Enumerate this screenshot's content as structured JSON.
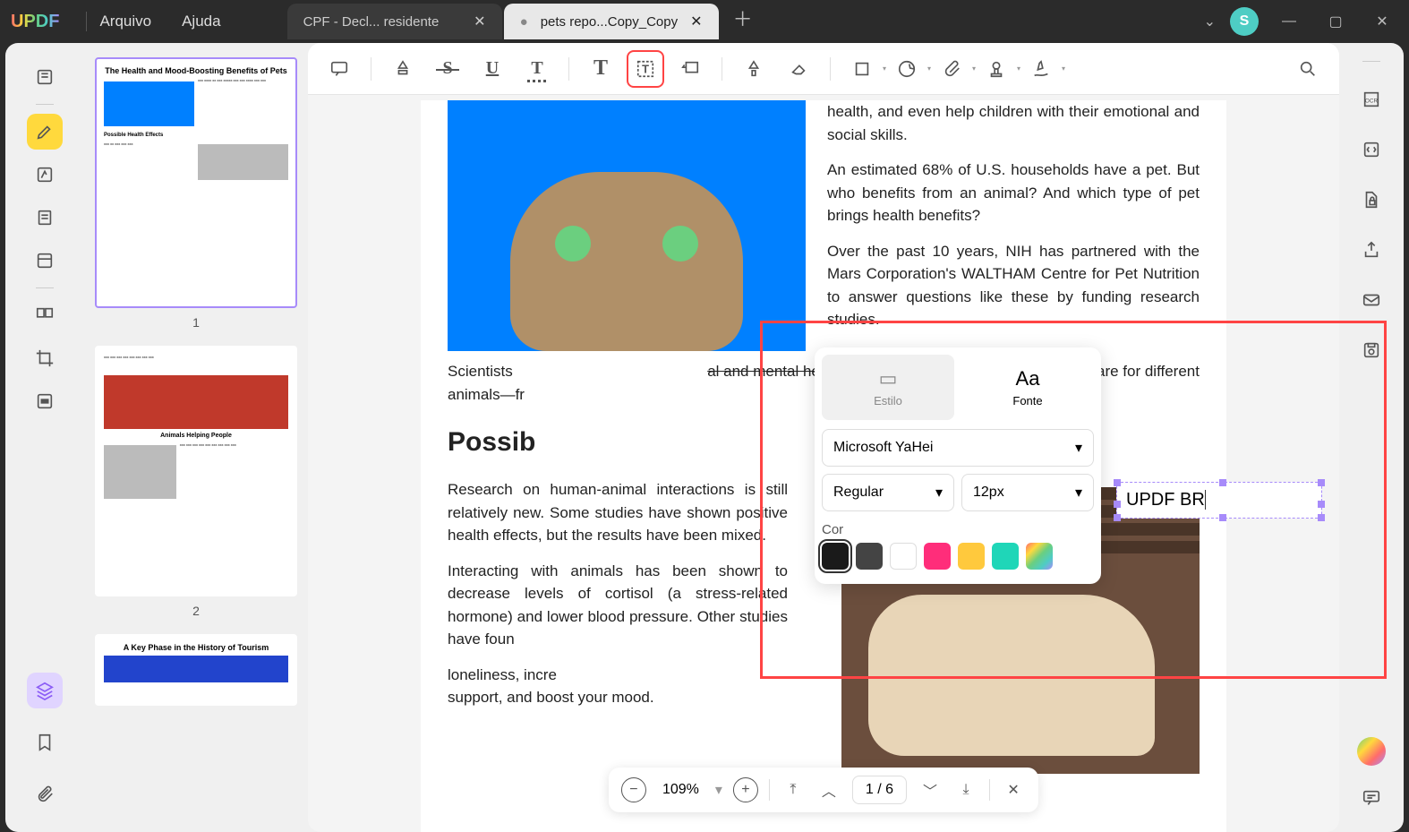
{
  "app": {
    "logo": "UPDF"
  },
  "menu": {
    "file": "Arquivo",
    "help": "Ajuda"
  },
  "tabs": [
    {
      "title": "CPF - Decl... residente",
      "active": false
    },
    {
      "title": "pets repo...Copy_Copy",
      "active": true
    }
  ],
  "windowControls": {
    "avatar": "S"
  },
  "thumbnails": {
    "page1": {
      "num": "1",
      "title": "The Health and Mood-Boosting Benefits of Pets",
      "sub": "Possible Health Effects"
    },
    "page2": {
      "num": "2",
      "heading": "Animals Helping People"
    },
    "page3": {
      "title": "A Key Phase in the History of Tourism"
    }
  },
  "document": {
    "p1": "health, and even help children with their emotional and social skills.",
    "p2": "An estimated 68% of U.S. households have a pet. But who benefits from an animal? And which type of pet brings health benefits?",
    "p3": "Over the past 10 years, NIH has partnered with the Mars Corporation's WALTHAM Centre for Pet Nutrition to answer questions like these by funding research studies.",
    "p4a": "Scientists",
    "p4c": "are for different",
    "p4b": "al and mental health benefits",
    "p5": "animals—fr",
    "h2": "Possib",
    "p6": "Research on human-animal interactions is still relatively new. Some studies have shown positive health effects, but the results have been mixed.",
    "p7": "Interacting with animals has been shown to decrease levels of cortisol (a stress-related hormone) and lower blood pressure. Other studies have foun",
    "p8": "loneliness, incre",
    "p9": "support, and boost your mood."
  },
  "textbox": {
    "value": "UPDF BR"
  },
  "fontPopup": {
    "styleTab": "Estilo",
    "fontTab": "Fonte",
    "fontFamily": "Microsoft YaHei",
    "fontWeight": "Regular",
    "fontSize": "12px",
    "colorLabel": "Cor",
    "colors": [
      "#1a1a1a",
      "#444444",
      "#ffffff",
      "#ff2d7a",
      "#ffc93d",
      "#1fd6b8",
      "gradient"
    ]
  },
  "pager": {
    "zoom": "109%",
    "page": "1 / 6"
  }
}
